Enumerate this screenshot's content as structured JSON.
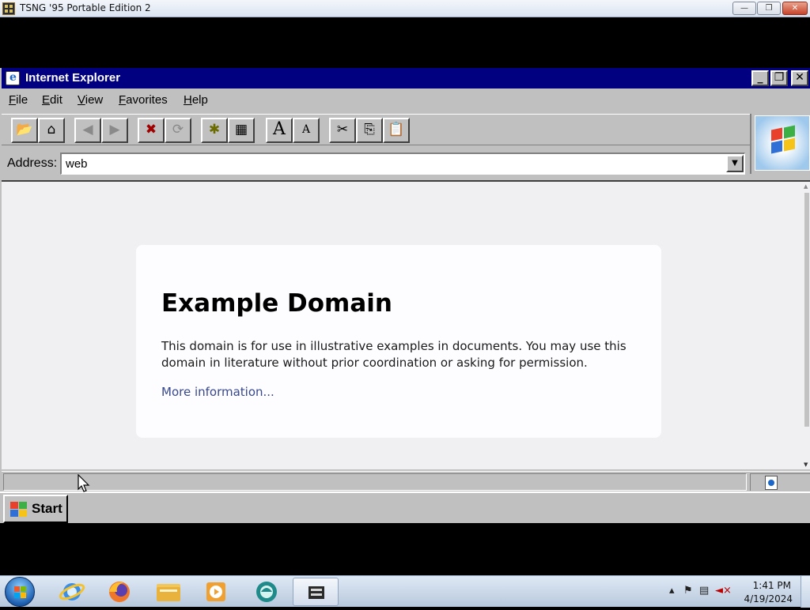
{
  "host_window": {
    "title": "TSNG '95 Portable Edition 2",
    "minimize_label": "—",
    "restore_label": "❐",
    "close_label": "✕"
  },
  "ie": {
    "title": "Internet Explorer",
    "menu": [
      {
        "first": "F",
        "rest": "ile"
      },
      {
        "first": "E",
        "rest": "dit"
      },
      {
        "first": "V",
        "rest": "iew"
      },
      {
        "first": "F",
        "rest": "avorites"
      },
      {
        "first": "H",
        "rest": "elp"
      }
    ],
    "toolbar": {
      "open": "📂",
      "home": "⌂",
      "back": "◀",
      "forward": "▶",
      "stop": "✖",
      "refresh": "⟳",
      "open_favorites": "✱",
      "add_favorites": "▦",
      "font_larger": "A",
      "font_smaller": "A",
      "cut": "✂",
      "copy": "⎘",
      "paste": "📋"
    },
    "address_label": "Address:",
    "address_value": "web",
    "title_buttons": {
      "minimize": "_",
      "restore": "❐",
      "close": "✕"
    }
  },
  "page": {
    "heading": "Example Domain",
    "description": "This domain is for use in illustrative examples in documents. You may use this domain in literature without prior coordination or asking for permission.",
    "link": "More information..."
  },
  "w95_taskbar": {
    "start_label": "Start"
  },
  "host_taskbar": {
    "time": "1:41 PM",
    "date": "4/19/2024",
    "tray_icons": [
      "chevron-up-icon",
      "flag-icon",
      "network-icon",
      "muted-speaker-icon"
    ],
    "pinned": [
      "internet-explorer-icon",
      "firefox-icon",
      "file-explorer-icon",
      "media-player-icon",
      "app-icon",
      "tsng-icon"
    ]
  }
}
